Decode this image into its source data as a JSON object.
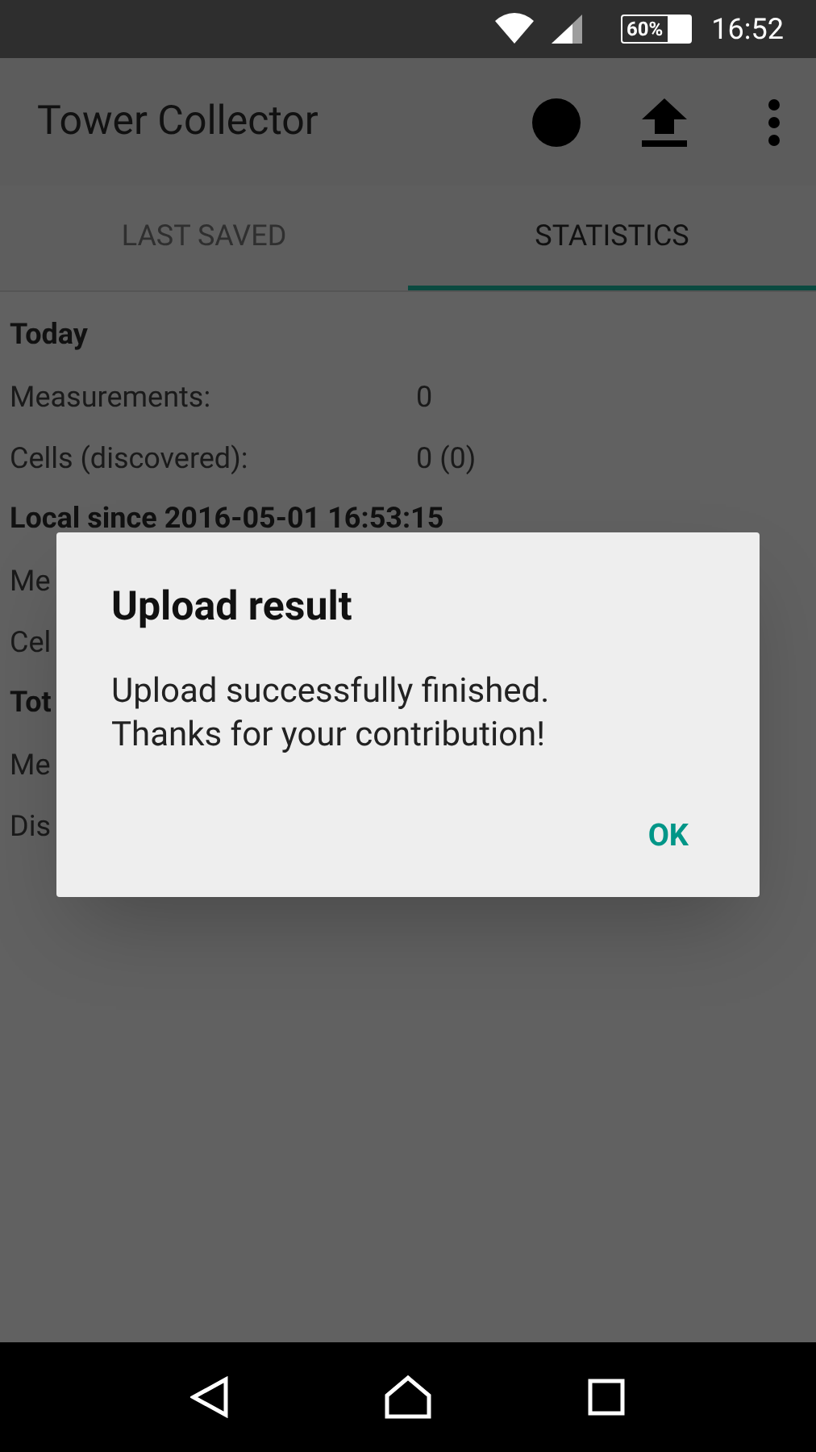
{
  "status_bar": {
    "battery": "60%",
    "time": "16:52"
  },
  "app_bar": {
    "title": "Tower Collector"
  },
  "tabs": [
    {
      "label": "LAST SAVED",
      "selected": false
    },
    {
      "label": "STATISTICS",
      "selected": true
    }
  ],
  "sections": [
    {
      "title": "Today",
      "rows": [
        {
          "label": "Measurements:",
          "value": "0"
        },
        {
          "label": "Cells (discovered):",
          "value": "0 (0)"
        }
      ]
    },
    {
      "title": "Local since 2016-05-01 16:53:15",
      "rows": [
        {
          "label": "Me"
        },
        {
          "label": "Cel"
        }
      ]
    },
    {
      "title": "Tot",
      "rows": [
        {
          "label": "Me"
        },
        {
          "label": "Dis"
        }
      ]
    }
  ],
  "dialog": {
    "title": "Upload result",
    "message": [
      "Upload successfully finished.",
      "Thanks for your contribution!"
    ],
    "button": "OK"
  }
}
